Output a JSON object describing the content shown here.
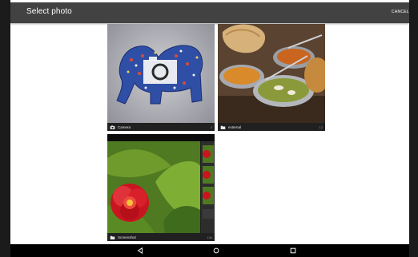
{
  "header": {
    "title": "Select photo",
    "cancel_label": "CANCEL"
  },
  "tiles": [
    {
      "label": "Camera",
      "icon": "camera-icon",
      "count": "3"
    },
    {
      "label": "external",
      "icon": "folder-icon",
      "count": "12"
    },
    {
      "label": "Screenshot",
      "icon": "folder-icon",
      "count": "136"
    }
  ],
  "navbar": {
    "buttons": [
      "back-icon",
      "home-icon",
      "recents-icon"
    ]
  },
  "colors": {
    "app_bar": "#424242",
    "navbar": "#000000",
    "tile_footer": "#202020",
    "frame": "#1b1b1b"
  }
}
